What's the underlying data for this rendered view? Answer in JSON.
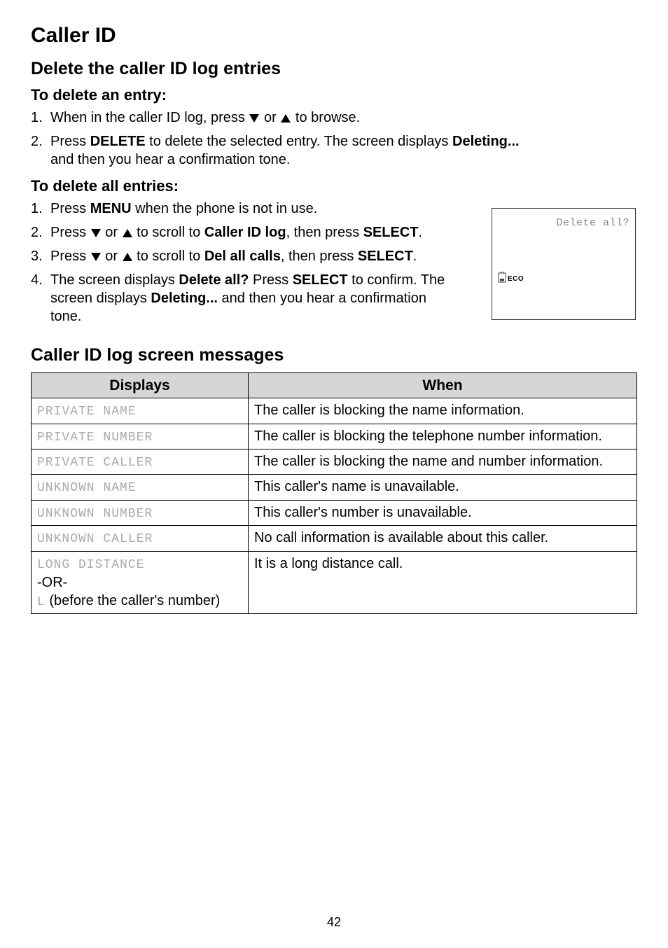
{
  "page_title": "Caller ID",
  "section_delete": {
    "heading": "Delete the caller ID log entries",
    "entry_subhead": "To delete an entry:",
    "entry_steps": [
      {
        "pre": "When in the caller ID log, press ",
        "mid": " or ",
        "post": " to browse."
      },
      {
        "a": "Press ",
        "b": "DELETE",
        "c": " to delete the selected entry. The screen displays ",
        "d": "Deleting...",
        "e": " and then you hear a confirmation tone."
      }
    ],
    "all_subhead": "To delete all entries:",
    "all_steps": [
      {
        "a": "Press ",
        "b": "MENU",
        "c": " when the phone is not in use."
      },
      {
        "a": "Press ",
        "mid": " or ",
        "b": " to scroll to ",
        "c": "Caller ID log",
        "d": ", then press ",
        "e": "SELECT",
        "f": "."
      },
      {
        "a": "Press ",
        "mid": " or ",
        "b": " to scroll to ",
        "c": "Del all calls",
        "d": ", then press ",
        "e": "SELECT",
        "f": "."
      },
      {
        "a": "The screen displays ",
        "b": "Delete all?",
        "c": " Press ",
        "d": "SELECT",
        "e": " to confirm. The screen displays ",
        "f": "Deleting...",
        "g": " and then you hear a confirmation tone."
      }
    ]
  },
  "screen_box": {
    "line1": "Delete all?",
    "eco": "ECO"
  },
  "section_messages": {
    "heading": "Caller ID log screen messages",
    "headers": {
      "displays": "Displays",
      "when": "When"
    },
    "rows": [
      {
        "display_lcd": "PRIVATE NAME",
        "when": "The caller is blocking the name information."
      },
      {
        "display_lcd": "PRIVATE NUMBER",
        "when": "The caller is blocking the telephone number information."
      },
      {
        "display_lcd": "PRIVATE CALLER",
        "when": "The caller is blocking the name and number information."
      },
      {
        "display_lcd": "UNKNOWN NAME",
        "when": "This caller's name is unavailable."
      },
      {
        "display_lcd": "UNKNOWN NUMBER",
        "when": "This caller's number is unavailable."
      },
      {
        "display_lcd": "UNKNOWN CALLER",
        "when": "No call information is available about this caller."
      },
      {
        "display_lcd": "LONG DISTANCE",
        "or": "-OR-",
        "l_lcd": "L",
        "l_after": " (before the caller's number)",
        "when": "It is a long distance call."
      }
    ]
  },
  "page_number": "42"
}
